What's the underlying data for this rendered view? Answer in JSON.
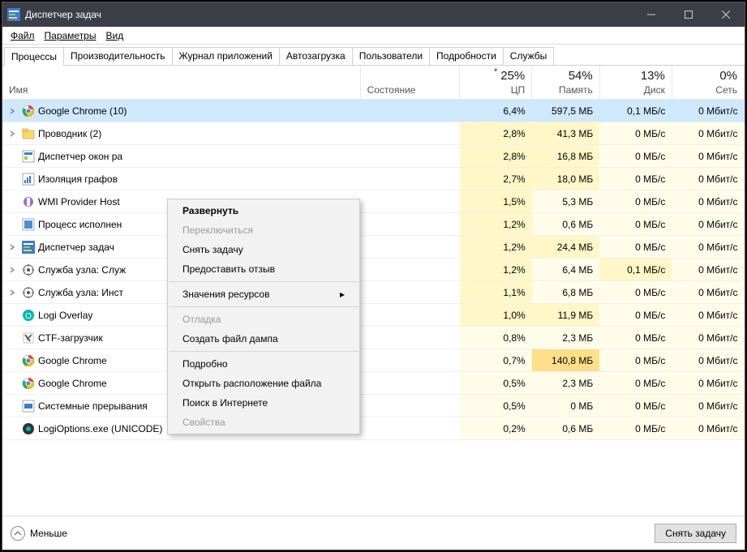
{
  "window": {
    "title": "Диспетчер задач"
  },
  "menubar": {
    "file": "Файл",
    "options": "Параметры",
    "view": "Вид"
  },
  "tabs": [
    {
      "label": "Процессы",
      "active": true
    },
    {
      "label": "Производительность"
    },
    {
      "label": "Журнал приложений"
    },
    {
      "label": "Автозагрузка"
    },
    {
      "label": "Пользователи"
    },
    {
      "label": "Подробности"
    },
    {
      "label": "Службы"
    }
  ],
  "columns": {
    "name": "Имя",
    "state": "Состояние",
    "cpu": {
      "pct": "25%",
      "label": "ЦП"
    },
    "memory": {
      "pct": "54%",
      "label": "Память"
    },
    "disk": {
      "pct": "13%",
      "label": "Диск"
    },
    "network": {
      "pct": "0%",
      "label": "Сеть"
    }
  },
  "processes": [
    {
      "name": "Google Chrome (10)",
      "icon": "chrome",
      "expand": true,
      "cpu": "6,4%",
      "mem": "597,5 МБ",
      "disk": "0,1 МБ/с",
      "net": "0 Мбит/с",
      "selected": true,
      "heat": {
        "cpu": 2,
        "mem": 4,
        "disk": 1,
        "net": 0
      }
    },
    {
      "name": "Проводник (2)",
      "icon": "explorer",
      "expand": true,
      "cpu": "2,8%",
      "mem": "41,3 МБ",
      "disk": "0 МБ/с",
      "net": "0 Мбит/с",
      "heat": {
        "cpu": 1,
        "mem": 1,
        "disk": 0,
        "net": 0
      }
    },
    {
      "name": "Диспетчер окон ра",
      "icon": "dwm",
      "cpu": "2,8%",
      "mem": "16,8 МБ",
      "disk": "0 МБ/с",
      "net": "0 Мбит/с",
      "heat": {
        "cpu": 1,
        "mem": 1,
        "disk": 0,
        "net": 0
      }
    },
    {
      "name": "Изоляция графов",
      "icon": "audio",
      "cpu": "2,7%",
      "mem": "18,0 МБ",
      "disk": "0 МБ/с",
      "net": "0 Мбит/с",
      "heat": {
        "cpu": 1,
        "mem": 1,
        "disk": 0,
        "net": 0
      }
    },
    {
      "name": "WMI Provider Host",
      "icon": "wmi",
      "cpu": "1,5%",
      "mem": "5,3 МБ",
      "disk": "0 МБ/с",
      "net": "0 Мбит/с",
      "heat": {
        "cpu": 1,
        "mem": 0,
        "disk": 0,
        "net": 0
      }
    },
    {
      "name": "Процесс исполнен",
      "icon": "proc",
      "cpu": "1,2%",
      "mem": "0,6 МБ",
      "disk": "0 МБ/с",
      "net": "0 Мбит/с",
      "heat": {
        "cpu": 1,
        "mem": 0,
        "disk": 0,
        "net": 0
      }
    },
    {
      "name": "Диспетчер задач",
      "icon": "taskmgr",
      "expand": true,
      "cpu": "1,2%",
      "mem": "24,4 МБ",
      "disk": "0 МБ/с",
      "net": "0 Мбит/с",
      "heat": {
        "cpu": 1,
        "mem": 1,
        "disk": 0,
        "net": 0
      }
    },
    {
      "name": "Служба узла: Служ",
      "icon": "svc",
      "expand": true,
      "cpu": "1,2%",
      "mem": "6,4 МБ",
      "disk": "0,1 МБ/с",
      "net": "0 Мбит/с",
      "heat": {
        "cpu": 1,
        "mem": 0,
        "disk": 1,
        "net": 0
      }
    },
    {
      "name": "Служба узла: Инст",
      "icon": "svc",
      "expand": true,
      "cpu": "1,1%",
      "mem": "6,8 МБ",
      "disk": "0 МБ/с",
      "net": "0 Мбит/с",
      "heat": {
        "cpu": 1,
        "mem": 0,
        "disk": 0,
        "net": 0
      }
    },
    {
      "name": "Logi Overlay",
      "icon": "logi",
      "cpu": "1,0%",
      "mem": "11,9 МБ",
      "disk": "0 МБ/с",
      "net": "0 Мбит/с",
      "heat": {
        "cpu": 1,
        "mem": 1,
        "disk": 0,
        "net": 0
      }
    },
    {
      "name": "CTF-загрузчик",
      "icon": "ctf",
      "cpu": "0,8%",
      "mem": "2,3 МБ",
      "disk": "0 МБ/с",
      "net": "0 Мбит/с",
      "heat": {
        "cpu": 0,
        "mem": 0,
        "disk": 0,
        "net": 0
      }
    },
    {
      "name": "Google Chrome",
      "icon": "chrome",
      "cpu": "0,7%",
      "mem": "140,8 МБ",
      "disk": "0 МБ/с",
      "net": "0 Мбит/с",
      "heat": {
        "cpu": 0,
        "mem": 3,
        "disk": 0,
        "net": 0
      }
    },
    {
      "name": "Google Chrome",
      "icon": "chrome",
      "cpu": "0,5%",
      "mem": "2,3 МБ",
      "disk": "0 МБ/с",
      "net": "0 Мбит/с",
      "heat": {
        "cpu": 0,
        "mem": 0,
        "disk": 0,
        "net": 0
      }
    },
    {
      "name": "Системные прерывания",
      "icon": "sys",
      "cpu": "0,5%",
      "mem": "0 МБ",
      "disk": "0 МБ/с",
      "net": "0 Мбит/с",
      "heat": {
        "cpu": 0,
        "mem": 0,
        "disk": 0,
        "net": 0
      }
    },
    {
      "name": "LogiOptions.exe (UNICODE)",
      "icon": "logiopt",
      "cpu": "0,2%",
      "mem": "0,6 МБ",
      "disk": "0 МБ/с",
      "net": "0 Мбит/с",
      "heat": {
        "cpu": 0,
        "mem": 0,
        "disk": 0,
        "net": 0
      }
    }
  ],
  "context_menu": [
    {
      "label": "Развернуть",
      "bold": true
    },
    {
      "label": "Переключиться",
      "disabled": true
    },
    {
      "label": "Снять задачу",
      "highlight": true
    },
    {
      "label": "Предоставить отзыв"
    },
    {
      "sep": true
    },
    {
      "label": "Значения ресурсов",
      "submenu": true
    },
    {
      "sep": true
    },
    {
      "label": "Отладка",
      "disabled": true
    },
    {
      "label": "Создать файл дампа"
    },
    {
      "sep": true
    },
    {
      "label": "Подробно"
    },
    {
      "label": "Открыть расположение файла"
    },
    {
      "label": "Поиск в Интернете"
    },
    {
      "label": "Свойства",
      "disabled": true
    }
  ],
  "footer": {
    "fewer": "Меньше",
    "end_task": "Снять задачу"
  }
}
